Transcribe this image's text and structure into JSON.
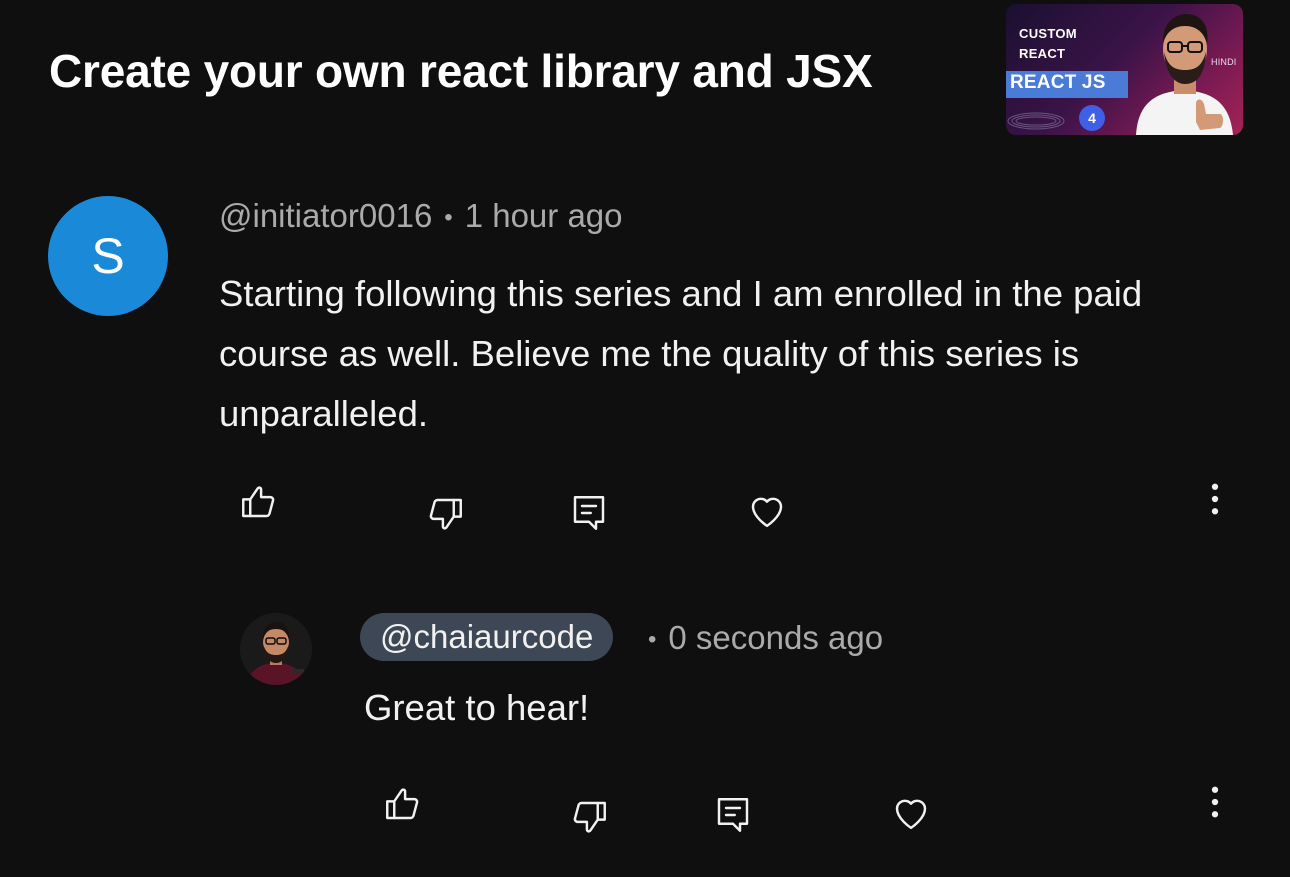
{
  "video": {
    "title": "Create your own react library and JSX",
    "thumbnail": {
      "line1": "CUSTOM",
      "line2": "REACT",
      "banner": "REACT JS",
      "language": "HINDI",
      "episode": "4"
    }
  },
  "comment": {
    "avatar_letter": "S",
    "avatar_color": "#1a8ad8",
    "author": "@initiator0016",
    "separator": "•",
    "time": "1 hour ago",
    "text": "Starting following this series and I am enrolled in the paid course as well. Believe me the quality of this series is unparalleled.",
    "actions": [
      "like-icon",
      "dislike-icon",
      "reply-icon",
      "heart-icon",
      "more-icon"
    ]
  },
  "reply": {
    "author": "@chaiaurcode",
    "separator": "•",
    "time": "0 seconds ago",
    "text": "Great to hear!",
    "pill_color": "#3e4755",
    "actions": [
      "like-icon",
      "dislike-icon",
      "reply-icon",
      "heart-icon",
      "more-icon"
    ]
  },
  "colors": {
    "background": "#0f0f0f",
    "primary_text": "#f1f1f1",
    "secondary_text": "#aaaaaa"
  }
}
